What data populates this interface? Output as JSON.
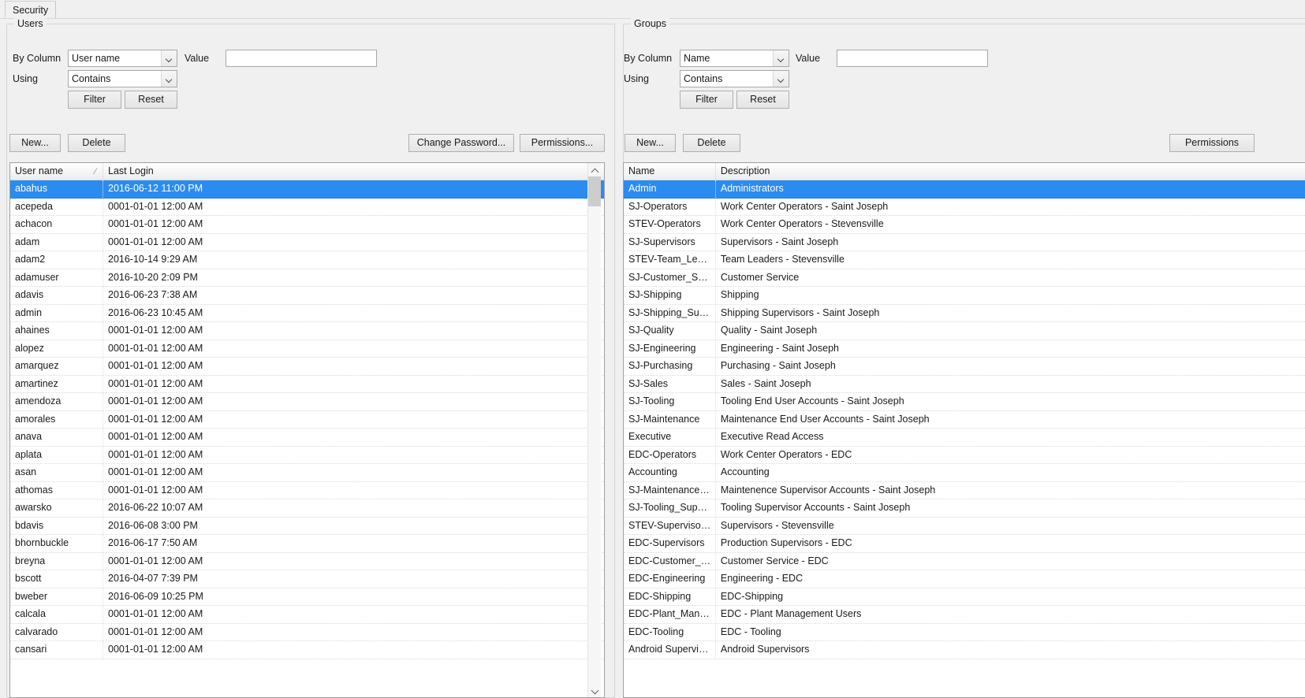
{
  "window": {
    "tab_label": "Security"
  },
  "users_panel": {
    "title": "Users",
    "filter": {
      "by_column_label": "By Column",
      "by_column_value": "User name",
      "using_label": "Using",
      "using_value": "Contains",
      "value_label": "Value",
      "value_text": "",
      "value_placeholder": "",
      "filter_button": "Filter",
      "reset_button": "Reset"
    },
    "toolbar": {
      "new_button": "New...",
      "delete_button": "Delete",
      "change_password_button": "Change Password...",
      "permissions_button": "Permissions..."
    },
    "list": {
      "columns": [
        "User name",
        "Last Login"
      ],
      "sort_column": "User name",
      "sort_indicator": "⁄",
      "selected_index": 0,
      "rows": [
        {
          "username": "abahus",
          "last_login": "2016-06-12 11:00 PM"
        },
        {
          "username": "acepeda",
          "last_login": "0001-01-01 12:00 AM"
        },
        {
          "username": "achacon",
          "last_login": "0001-01-01 12:00 AM"
        },
        {
          "username": "adam",
          "last_login": "0001-01-01 12:00 AM"
        },
        {
          "username": "adam2",
          "last_login": "2016-10-14 9:29 AM"
        },
        {
          "username": "adamuser",
          "last_login": "2016-10-20 2:09 PM"
        },
        {
          "username": "adavis",
          "last_login": "2016-06-23 7:38 AM"
        },
        {
          "username": "admin",
          "last_login": "2016-06-23 10:45 AM"
        },
        {
          "username": "ahaines",
          "last_login": "0001-01-01 12:00 AM"
        },
        {
          "username": "alopez",
          "last_login": "0001-01-01 12:00 AM"
        },
        {
          "username": "amarquez",
          "last_login": "0001-01-01 12:00 AM"
        },
        {
          "username": "amartinez",
          "last_login": "0001-01-01 12:00 AM"
        },
        {
          "username": "amendoza",
          "last_login": "0001-01-01 12:00 AM"
        },
        {
          "username": "amorales",
          "last_login": "0001-01-01 12:00 AM"
        },
        {
          "username": "anava",
          "last_login": "0001-01-01 12:00 AM"
        },
        {
          "username": "aplata",
          "last_login": "0001-01-01 12:00 AM"
        },
        {
          "username": "asan",
          "last_login": "0001-01-01 12:00 AM"
        },
        {
          "username": "athomas",
          "last_login": "0001-01-01 12:00 AM"
        },
        {
          "username": "awarsko",
          "last_login": "2016-06-22 10:07 AM"
        },
        {
          "username": "bdavis",
          "last_login": "2016-06-08 3:00 PM"
        },
        {
          "username": "bhornbuckle",
          "last_login": "2016-06-17 7:50 AM"
        },
        {
          "username": "breyna",
          "last_login": "0001-01-01 12:00 AM"
        },
        {
          "username": "bscott",
          "last_login": "2016-04-07 7:39 PM"
        },
        {
          "username": "bweber",
          "last_login": "2016-06-09 10:25 PM"
        },
        {
          "username": "calcala",
          "last_login": "0001-01-01 12:00 AM"
        },
        {
          "username": "calvarado",
          "last_login": "0001-01-01 12:00 AM"
        },
        {
          "username": "cansari",
          "last_login": "0001-01-01 12:00 AM"
        }
      ]
    }
  },
  "groups_panel": {
    "title": "Groups",
    "filter": {
      "by_column_label": "By Column",
      "by_column_value": "Name",
      "using_label": "Using",
      "using_value": "Contains",
      "value_label": "Value",
      "value_text": "",
      "value_placeholder": "",
      "filter_button": "Filter",
      "reset_button": "Reset"
    },
    "toolbar": {
      "new_button": "New...",
      "delete_button": "Delete",
      "permissions_button": "Permissions"
    },
    "list": {
      "columns": [
        "Name",
        "Description"
      ],
      "selected_index": 0,
      "rows": [
        {
          "name": "Admin",
          "description": "Administrators"
        },
        {
          "name": "SJ-Operators",
          "description": "Work Center Operators - Saint Joseph"
        },
        {
          "name": "STEV-Operators",
          "description": "Work Center Operators - Stevensville"
        },
        {
          "name": "SJ-Supervisors",
          "description": "Supervisors - Saint Joseph"
        },
        {
          "name": "STEV-Team_Le…",
          "description": "Team Leaders - Stevensville"
        },
        {
          "name": "SJ-Customer_S…",
          "description": "Customer Service"
        },
        {
          "name": "SJ-Shipping",
          "description": "Shipping"
        },
        {
          "name": "SJ-Shipping_Su…",
          "description": "Shipping Supervisors - Saint Joseph"
        },
        {
          "name": "SJ-Quality",
          "description": "Quality - Saint Joseph"
        },
        {
          "name": "SJ-Engineering",
          "description": "Engineering - Saint Joseph"
        },
        {
          "name": "SJ-Purchasing",
          "description": "Purchasing - Saint Joseph"
        },
        {
          "name": "SJ-Sales",
          "description": "Sales - Saint Joseph"
        },
        {
          "name": "SJ-Tooling",
          "description": "Tooling End User Accounts - Saint Joseph"
        },
        {
          "name": "SJ-Maintenance",
          "description": "Maintenance End User Accounts - Saint Joseph"
        },
        {
          "name": "Executive",
          "description": "Executive Read Access"
        },
        {
          "name": "EDC-Operators",
          "description": "Work Center Operators - EDC"
        },
        {
          "name": "Accounting",
          "description": "Accounting"
        },
        {
          "name": "SJ-Maintenance…",
          "description": "Maintenence Supervisor Accounts - Saint Joseph"
        },
        {
          "name": "SJ-Tooling_Sup…",
          "description": "Tooling Supervisor Accounts - Saint Joseph"
        },
        {
          "name": "STEV-Superviso…",
          "description": "Supervisors - Stevensville"
        },
        {
          "name": "EDC-Supervisors",
          "description": "Production Supervisors - EDC"
        },
        {
          "name": "EDC-Customer_…",
          "description": "Customer Service - EDC"
        },
        {
          "name": "EDC-Engineering",
          "description": "Engineering - EDC"
        },
        {
          "name": "EDC-Shipping",
          "description": "EDC-Shipping"
        },
        {
          "name": "EDC-Plant_Man…",
          "description": "EDC - Plant Management Users"
        },
        {
          "name": "EDC-Tooling",
          "description": "EDC - Tooling"
        },
        {
          "name": "Android Supervi…",
          "description": "Android Supervisors"
        }
      ]
    }
  },
  "colors": {
    "selection": "#2a8cf0",
    "window_bg": "#f0f0f0",
    "list_bg": "#ffffff"
  }
}
